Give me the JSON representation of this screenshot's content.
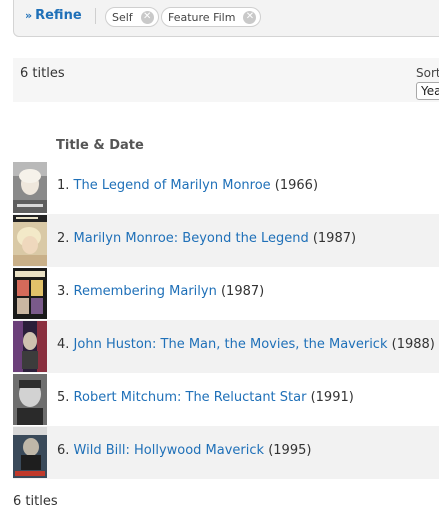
{
  "refine": {
    "label": "Refine",
    "chips": [
      {
        "label": "Self"
      },
      {
        "label": "Feature Film"
      }
    ]
  },
  "results": {
    "count_top": "6 titles",
    "count_bottom": "6 titles",
    "sort_label": "Sort",
    "sort_value": "Yea",
    "column_header": "Title & Date",
    "items": [
      {
        "num": "1.",
        "title": "The Legend of Marilyn Monroe",
        "year": "(1966)"
      },
      {
        "num": "2.",
        "title": "Marilyn Monroe: Beyond the Legend",
        "year": "(1987)"
      },
      {
        "num": "3.",
        "title": "Remembering Marilyn",
        "year": "(1987)"
      },
      {
        "num": "4.",
        "title": "John Huston: The Man, the Movies, the Maverick",
        "year": "(1988)"
      },
      {
        "num": "5.",
        "title": "Robert Mitchum: The Reluctant Star",
        "year": "(1991)"
      },
      {
        "num": "6.",
        "title": "Wild Bill: Hollywood Maverick",
        "year": "(1995)"
      }
    ]
  },
  "colors": {
    "link": "#1f70b8",
    "alt_row": "#f2f2f2"
  }
}
